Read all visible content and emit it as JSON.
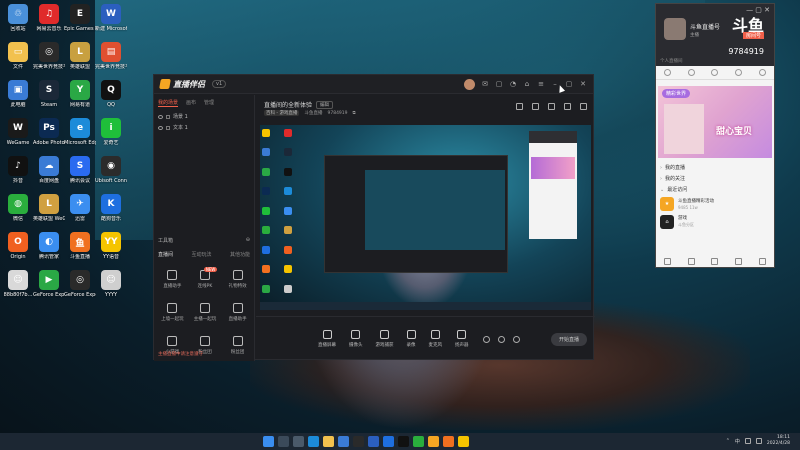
{
  "desktop": {
    "icons": [
      {
        "label": "回收站",
        "color": "#4a90d9",
        "glyph": "♲"
      },
      {
        "label": "网易云音乐",
        "color": "#e02b2b",
        "glyph": "♫"
      },
      {
        "label": "Epic Games Launcher",
        "color": "#222222",
        "glyph": "E"
      },
      {
        "label": "新建 Microsoft Word 文档",
        "color": "#2b5fbf",
        "glyph": "W"
      },
      {
        "label": "文件",
        "color": "#f2c14e",
        "glyph": "▭"
      },
      {
        "label": "完美世界竞技平台",
        "color": "#2a2a2a",
        "glyph": "◎"
      },
      {
        "label": "英雄联盟",
        "color": "#c8a040",
        "glyph": "L"
      },
      {
        "label": "完美世界竞技平台",
        "color": "#e05030",
        "glyph": "▤"
      },
      {
        "label": "此电脑",
        "color": "#3a7bd5",
        "glyph": "▣"
      },
      {
        "label": "Steam",
        "color": "#1b2838",
        "glyph": "S"
      },
      {
        "label": "网易有道",
        "color": "#2aa845",
        "glyph": "Y"
      },
      {
        "label": "QQ",
        "color": "#111111",
        "glyph": "Q"
      },
      {
        "label": "WeGame",
        "color": "#1a1a1a",
        "glyph": "W"
      },
      {
        "label": "Adobe Photoshop",
        "color": "#0b2a52",
        "glyph": "Ps"
      },
      {
        "label": "Microsoft Edge",
        "color": "#1c8bd9",
        "glyph": "e"
      },
      {
        "label": "爱奇艺",
        "color": "#1fbf3a",
        "glyph": "i"
      },
      {
        "label": "抖音",
        "color": "#111111",
        "glyph": "♪"
      },
      {
        "label": "百度网盘",
        "color": "#3a7bd5",
        "glyph": "☁"
      },
      {
        "label": "腾讯会议",
        "color": "#2a6bf0",
        "glyph": "S"
      },
      {
        "label": "Ubisoft Connect",
        "color": "#2b2b2b",
        "glyph": "◉"
      },
      {
        "label": "微信",
        "color": "#2aae3d",
        "glyph": "◍"
      },
      {
        "label": "英雄联盟 WeGame版",
        "color": "#d0a040",
        "glyph": "L"
      },
      {
        "label": "迅雷",
        "color": "#3b8ef0",
        "glyph": "✈"
      },
      {
        "label": "酷狗音乐",
        "color": "#1e6fe0",
        "glyph": "K"
      },
      {
        "label": "Origin",
        "color": "#f06020",
        "glyph": "O"
      },
      {
        "label": "腾讯管家",
        "color": "#3a8ef0",
        "glyph": "◐"
      },
      {
        "label": "斗鱼直播",
        "color": "#f07020",
        "glyph": "鱼"
      },
      {
        "label": "YY语音",
        "color": "#f5c400",
        "glyph": "YY"
      },
      {
        "label": "88b80f7b...",
        "color": "#d9d9d9",
        "glyph": "☺"
      },
      {
        "label": "GeForce Experience",
        "color": "#2aa845",
        "glyph": "▶"
      },
      {
        "label": "GeForce Experience",
        "color": "#2a2a2a",
        "glyph": "◎"
      },
      {
        "label": "YYYY",
        "color": "#cfcfcf",
        "glyph": "☺"
      }
    ]
  },
  "app": {
    "title": "直播伴侣",
    "version_badge": "v1",
    "left_tabs": [
      "我的场景",
      "画布",
      "管理"
    ],
    "scenes": [
      "场景 1",
      "文本 1"
    ],
    "tools_title": "工具箱",
    "tools_tabs": [
      "直播间",
      "互动玩法",
      "其他功能"
    ],
    "tools": [
      {
        "label": "直播助手",
        "badge": ""
      },
      {
        "label": "连线PK",
        "badge": "NEW"
      },
      {
        "label": "礼物特效",
        "badge": ""
      },
      {
        "label": "上墙一起玩",
        "badge": ""
      },
      {
        "label": "主播一起玩",
        "badge": ""
      },
      {
        "label": "直播助手",
        "badge": ""
      },
      {
        "label": "小游戏",
        "badge": ""
      },
      {
        "label": "粉丝团",
        "badge": ""
      },
      {
        "label": "粉丝团",
        "badge": ""
      }
    ],
    "left_footer": "主播直播中请注意遵守",
    "room_title": "直播间的全新体验",
    "room_edit": "编辑",
    "room_meta": {
      "tag": "百科 - 游戏直播",
      "host": "斗鱼直播",
      "room_id": "9784919"
    },
    "controls": [
      {
        "label": "直播屏幕"
      },
      {
        "label": "摄像头"
      },
      {
        "label": "游戏捕获"
      },
      {
        "label": "录像"
      },
      {
        "label": "麦克风"
      },
      {
        "label": "扬声器"
      }
    ],
    "start_button": "开始直播"
  },
  "chat_window": {
    "brand": "斗鱼",
    "room_label": "房间号",
    "room_id": "9784919",
    "user_name": "斗鱼直播号",
    "user_sub": "主播",
    "hint": "个人直播间",
    "banner_tag": "精彩世界",
    "banner_text": "甜心宝贝",
    "rows": [
      "我的直播",
      "我的关注",
      "最近访问"
    ],
    "cards": [
      {
        "title": "斗鱼直播精彩活动",
        "sub": "9485 11w",
        "color": "#f5a623",
        "glyph": "★"
      },
      {
        "title": "游戏",
        "sub": "斗鱼分区",
        "color": "#222222",
        "glyph": "⌂"
      }
    ]
  },
  "taskbar": {
    "tray_lang": "中",
    "time": "18:11",
    "date": "2022/4/28"
  },
  "colors": {
    "accent": "#f0604a",
    "brand_orange": "#f5a623",
    "taskbar": "#1c2733"
  }
}
